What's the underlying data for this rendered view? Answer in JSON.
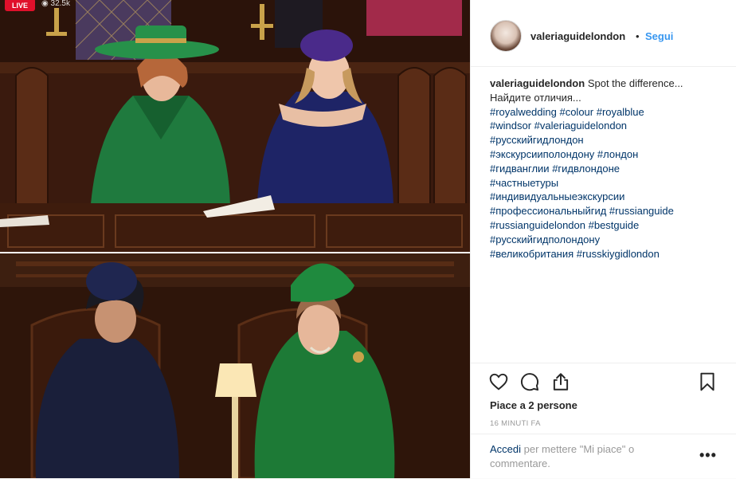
{
  "photo": {
    "live_badge": "LIVE",
    "viewer_count": "32.5k"
  },
  "header": {
    "username": "valeriaguidelondon",
    "separator": "•",
    "follow_label": "Segui"
  },
  "caption": {
    "username": "valeriaguidelondon",
    "text_line1": "Spot the difference...",
    "text_line2": "Найдите отличия...",
    "hashtags": [
      "#royalwedding",
      "#colour",
      "#royalblue",
      "#windsor",
      "#valeriaguidelondon",
      "#русскийгидлондон",
      "#экскурсииполондону",
      "#лондон",
      "#гидванглии",
      "#гидвлондоне",
      "#частныетуры",
      "#индивидуальныеэкскурсии",
      "#профессиональныйгид",
      "#russianguide",
      "#russianguidelondon",
      "#bestguide",
      "#русскийгидполондону",
      "#великобритания",
      "#russkiygidlondon"
    ]
  },
  "actions": {
    "likes_text": "Piace a 2 persone",
    "timestamp": "16 MINUTI FA",
    "login_link": "Accedi",
    "comment_prompt": " per mettere \"Mi piace\" o commentare.",
    "more_label": "•••"
  },
  "icons": {
    "like": "heart-icon",
    "comment": "comment-icon",
    "share": "share-icon",
    "save": "bookmark-icon",
    "more": "more-options-icon"
  },
  "colors": {
    "link_blue": "#3897f0",
    "hashtag": "#003569",
    "live_red": "#e0102b"
  }
}
